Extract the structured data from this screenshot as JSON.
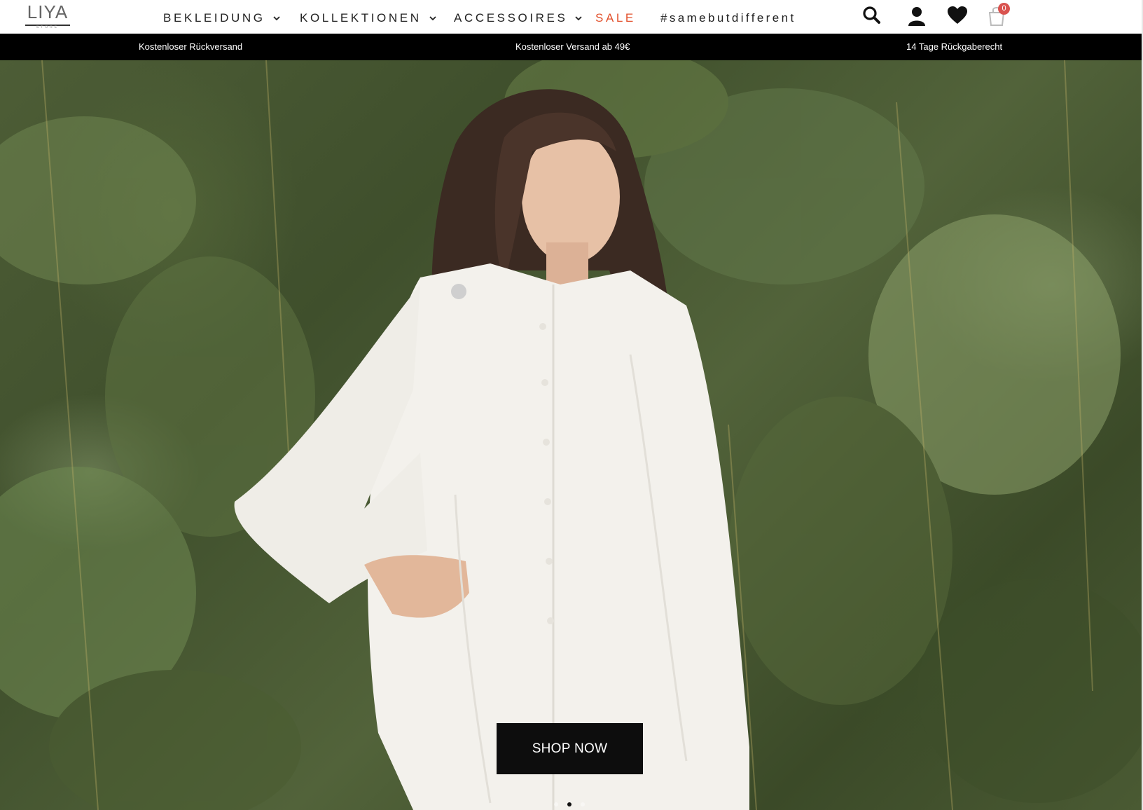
{
  "brand": {
    "logo_text": "LIYA",
    "logo_subtext": "STORE"
  },
  "nav": {
    "items": [
      {
        "label": "BEKLEIDUNG",
        "has_dropdown": true
      },
      {
        "label": "KOLLEKTIONEN",
        "has_dropdown": true
      },
      {
        "label": "ACCESSOIRES",
        "has_dropdown": true
      },
      {
        "label": "SALE",
        "has_dropdown": false,
        "color": "#e2502c"
      },
      {
        "label": "#samebutdifferent",
        "has_dropdown": false
      }
    ]
  },
  "header_icons": {
    "search": "search-icon",
    "account": "user-icon",
    "wishlist": "heart-icon",
    "cart": "cart-icon",
    "cart_count": "0",
    "cart_badge_color": "#d9534f"
  },
  "announcement": {
    "items": [
      "Kostenloser Rückversand",
      "Kostenloser Versand ab 49€",
      "14 Tage Rückgaberecht"
    ]
  },
  "hero": {
    "cta_label": "SHOP NOW",
    "slides_count": 3,
    "active_slide": 2
  },
  "colors": {
    "sale_accent": "#e2502c",
    "announcement_bg": "#000000",
    "cta_bg": "#0d0d0d"
  }
}
